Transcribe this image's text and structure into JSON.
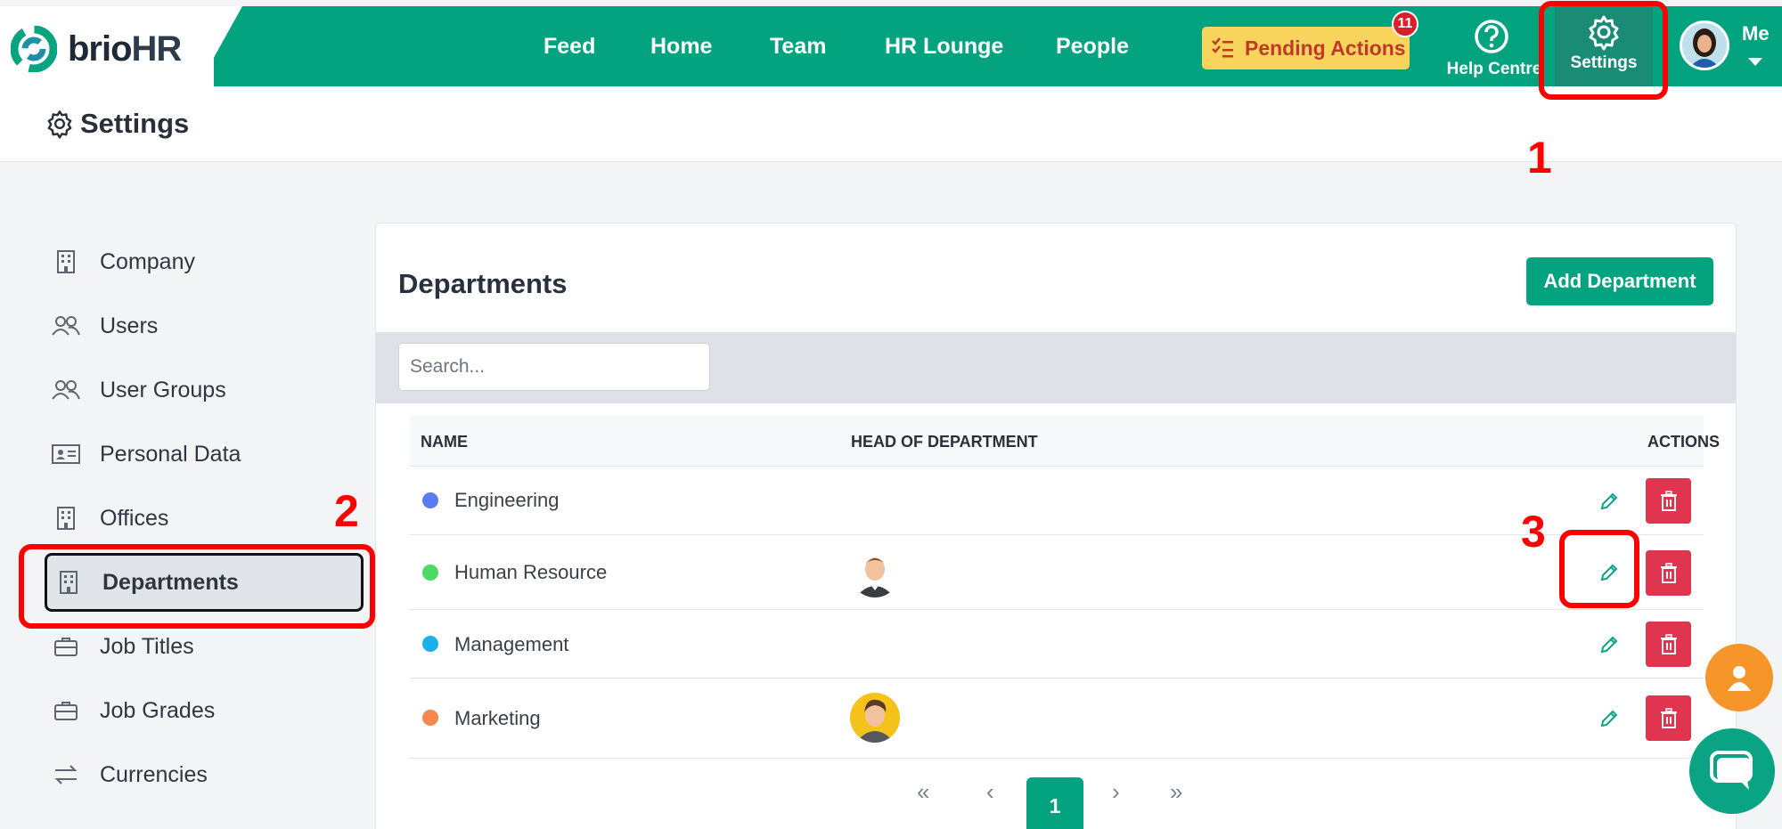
{
  "brand": {
    "name_part1": "brio",
    "name_part2": "HR"
  },
  "nav": {
    "items": [
      {
        "label": "Feed"
      },
      {
        "label": "Home"
      },
      {
        "label": "Team"
      },
      {
        "label": "HR Lounge"
      },
      {
        "label": "People"
      }
    ],
    "pending_actions": {
      "label": "Pending Actions",
      "count": "11"
    },
    "help_label": "Help Centre",
    "settings_label": "Settings",
    "user_label": "Me"
  },
  "page": {
    "title": "Settings"
  },
  "sidebar": {
    "items": [
      {
        "label": "Company",
        "icon": "building-icon"
      },
      {
        "label": "Users",
        "icon": "users-icon"
      },
      {
        "label": "User Groups",
        "icon": "users-icon"
      },
      {
        "label": "Personal Data",
        "icon": "id-card-icon"
      },
      {
        "label": "Offices",
        "icon": "building-icon"
      },
      {
        "label": "Departments",
        "icon": "building-icon",
        "active": true
      },
      {
        "label": "Job Titles",
        "icon": "briefcase-icon"
      },
      {
        "label": "Job Grades",
        "icon": "briefcase-icon"
      },
      {
        "label": "Currencies",
        "icon": "exchange-icon"
      }
    ]
  },
  "departments": {
    "title": "Departments",
    "add_button": "Add Department",
    "search_placeholder": "Search...",
    "columns": [
      "NAME",
      "HEAD OF DEPARTMENT",
      "ACTIONS"
    ],
    "rows": [
      {
        "name": "Engineering",
        "color": "#5b7cf0",
        "has_head": false
      },
      {
        "name": "Human Resource",
        "color": "#4cd964",
        "has_head": true
      },
      {
        "name": "Management",
        "color": "#1ab0e8",
        "has_head": false
      },
      {
        "name": "Marketing",
        "color": "#f4884f",
        "has_head": true
      }
    ],
    "pagination": {
      "first": "«",
      "prev": "‹",
      "current": "1",
      "next": "›",
      "last": "»"
    }
  },
  "annotations": [
    "1",
    "2",
    "3"
  ],
  "colors": {
    "primary": "#03a380",
    "danger": "#e0344f",
    "pending": "#f9d45c",
    "annotation": "#ff0000"
  }
}
